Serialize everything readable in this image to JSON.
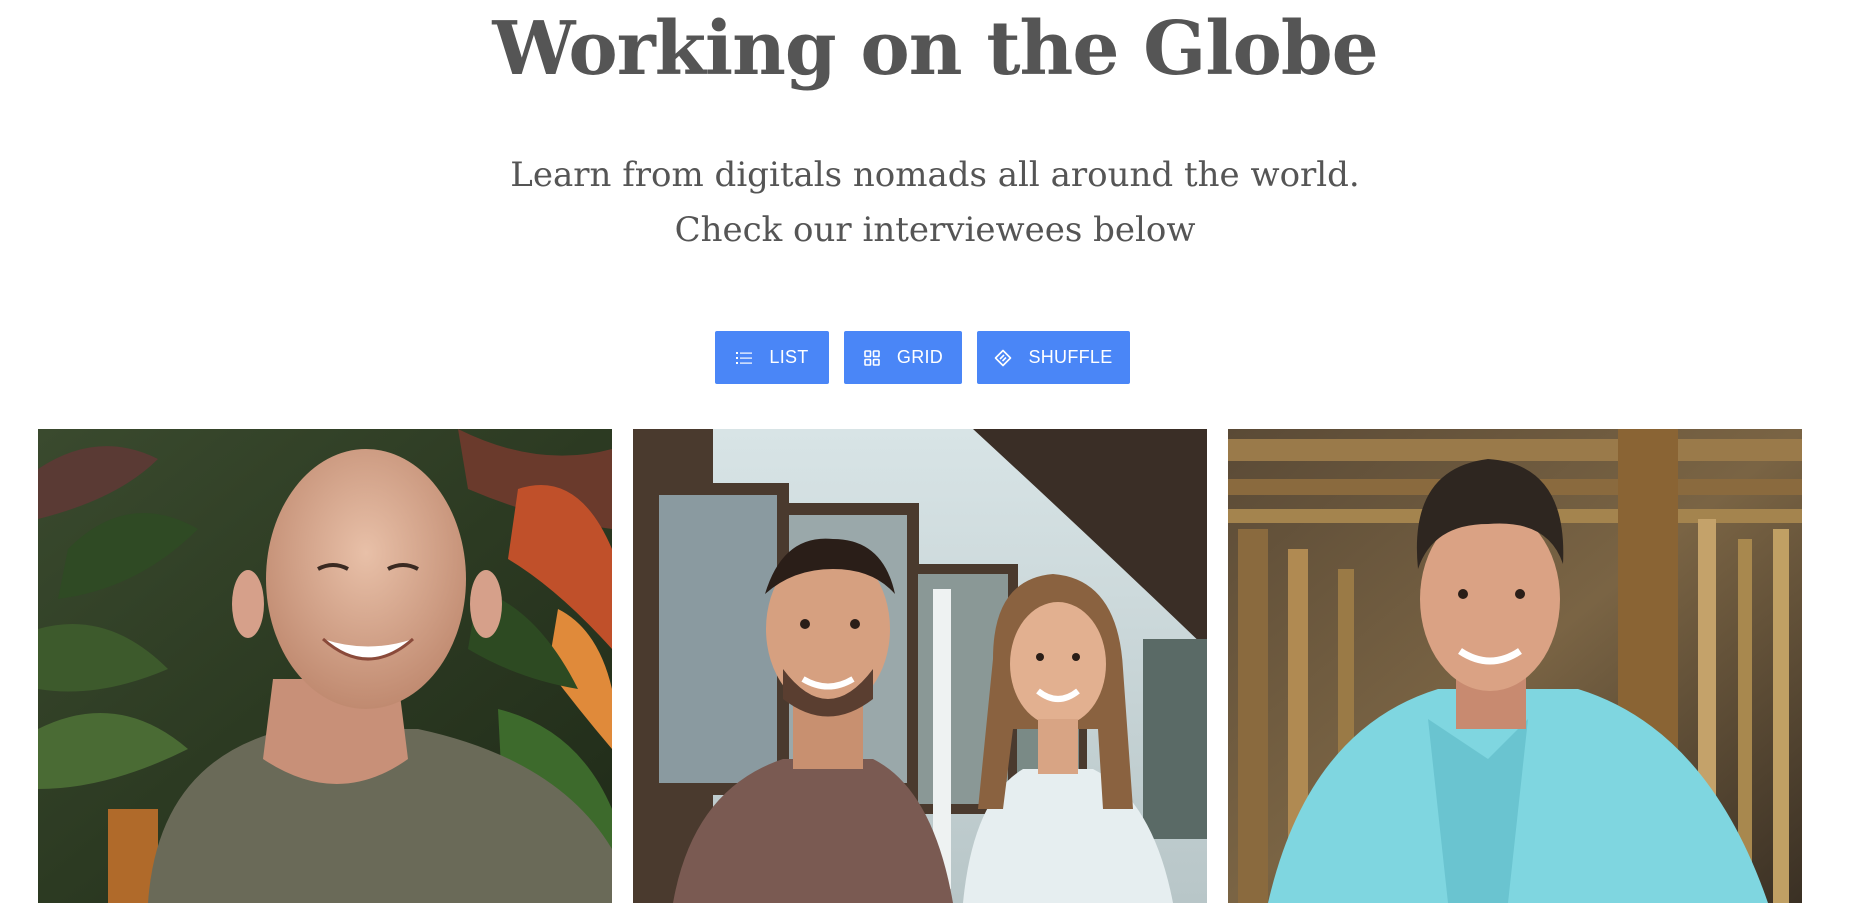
{
  "header": {
    "title": "Working on the Globe",
    "subtitle_line1": "Learn from digitals nomads all around the world.",
    "subtitle_line2": "Check our interviewees below"
  },
  "view_controls": {
    "buttons": [
      {
        "label": "LIST",
        "icon": "list-icon"
      },
      {
        "label": "GRID",
        "icon": "grid-icon"
      },
      {
        "label": "SHUFFLE",
        "icon": "shuffle-icon"
      }
    ],
    "button_color": "#4a86f7"
  },
  "interviewees": [
    {
      "photo": "bald man smiling in front of tropical plants"
    },
    {
      "photo": "young man and woman smiling on a veranda"
    },
    {
      "photo": "young man in white shirt in bamboo cafe"
    }
  ],
  "colors": {
    "text": "#555555",
    "accent": "#4a86f7",
    "background": "#ffffff"
  }
}
